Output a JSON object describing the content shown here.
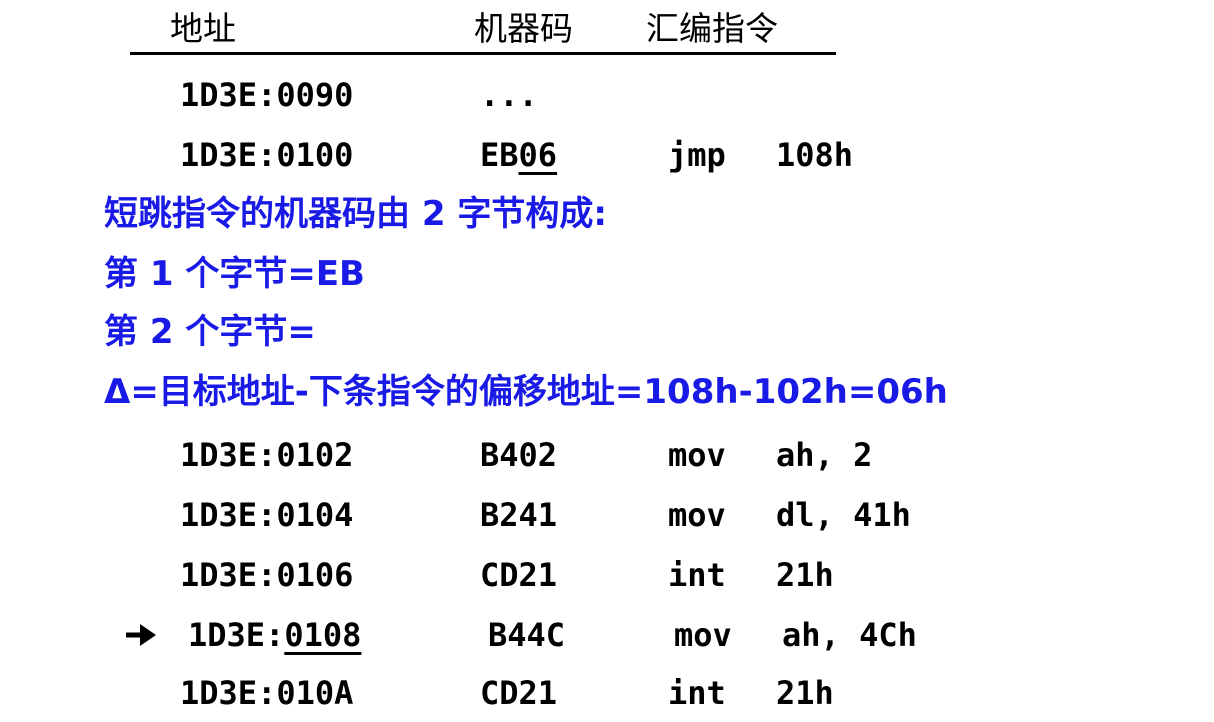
{
  "header": {
    "address": "地址",
    "machine_code": "机器码",
    "assembly": "汇编指令"
  },
  "rows_top": [
    {
      "address": "1D3E:0090",
      "machine_code": "...",
      "op": "",
      "args": ""
    },
    {
      "address": "1D3E:0100",
      "machine_code_prefix": "EB",
      "machine_code_underlined": "06",
      "op": "jmp",
      "args": "108h"
    }
  ],
  "notes": [
    "短跳指令的机器码由 2 字节构成:",
    "第 1 个字节=EB",
    "第 2 个字节=",
    "Δ=目标地址-下条指令的偏移地址=108h-102h=06h"
  ],
  "rows_bottom": [
    {
      "address": "1D3E:0102",
      "machine_code": "B402",
      "op": "mov",
      "args": "ah, 2"
    },
    {
      "address": "1D3E:0104",
      "machine_code": "B241",
      "op": "mov",
      "args": "dl, 41h"
    },
    {
      "address": "1D3E:0106",
      "machine_code": "CD21",
      "op": "int",
      "args": "21h"
    }
  ],
  "current_row": {
    "address_prefix": "1D3E:",
    "address_underlined": "0108",
    "machine_code": "B44C",
    "op": "mov",
    "args": "ah, 4Ch"
  },
  "last_row": {
    "address": "1D3E:010A",
    "machine_code": "CD21",
    "op": "int",
    "args": "21h"
  },
  "colors": {
    "note_text": "#1a1ae6",
    "text": "#000000"
  }
}
